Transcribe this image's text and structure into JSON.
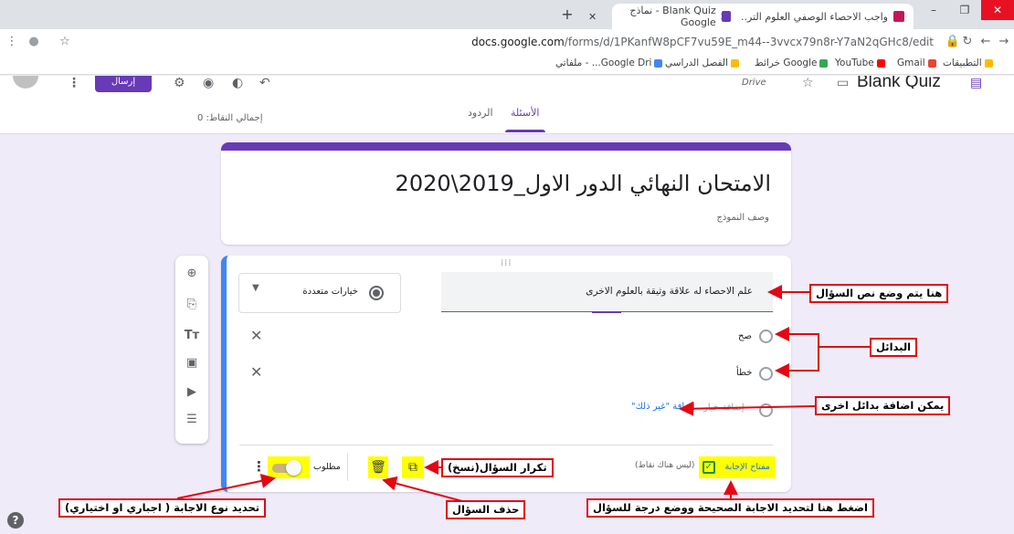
{
  "browser": {
    "tabs": [
      {
        "title": "واجب الاحصاء الوصفي العلوم التر..",
        "active": true,
        "favicon_color": "#c2185b"
      },
      {
        "title": "Blank Quiz - نماذج Google",
        "active": false,
        "favicon_color": "#673ab7"
      }
    ],
    "new_tab": "+",
    "window_controls": {
      "minimize": "–",
      "maximize": "❐",
      "close": "✕"
    },
    "url_domain": "docs.google.com",
    "url_path": "/forms/d/1PKanfW8pCF7vu59E_m44--3vvcx79n8r-Y7aN2qGHc8/edit",
    "bookmarks": [
      {
        "label": "التطبيقات",
        "color": "#fbbc04"
      },
      {
        "label": "Gmail",
        "color": "#ea4335"
      },
      {
        "label": "YouTube",
        "color": "#ff0000"
      },
      {
        "label": "خرائط Google",
        "color": "#34a853"
      },
      {
        "label": "الفصل الدراسي",
        "color": "#fbbc04"
      },
      {
        "label": "ملفاتي - ...Google Dri",
        "color": "#4285f4"
      }
    ]
  },
  "forms_header": {
    "doc_title": "Blank Quiz",
    "drive_label": "Drive",
    "send_label": "إرسال",
    "tabs": {
      "questions": "الأسئلة",
      "responses": "الردود"
    },
    "total_points": "إجمالي النقاط: 0"
  },
  "title_card": {
    "title": "الامتحان النهائي الدور الاول_2019\\2020",
    "description": "وصف النموذج"
  },
  "question": {
    "text": "علم الاحصاء له علاقة وثيقة بالعلوم الاخرى",
    "type": "خيارات متعددة",
    "options": [
      "صح",
      "خطأ"
    ],
    "add_option": "إضافة خيار",
    "add_other": "إضافة \"غير ذلك\"",
    "answer_key": "مفتاح الإجابة",
    "no_points": "(ليس هناك نقاط)",
    "required_label": "مطلوب",
    "required": true
  },
  "annotations": {
    "question_text": "هنا يتم وضع نص السؤال",
    "options": "البدائل",
    "add_options": "يمكن اضافة بدائل اخرى",
    "duplicate": "تكرار السؤال(نسخ)",
    "delete": "حذف السؤال",
    "answer_key": "اضغط هنا لتحديد الاجابة الصحيحة ووضع درجة للسؤال",
    "required_type": "تحديد نوع الاجابة ( اجباري او اختياري)"
  },
  "colors": {
    "accent": "#673ab7",
    "annotation_border": "#e30613",
    "highlight": "#ffff00",
    "card_focus": "#4285f4"
  }
}
